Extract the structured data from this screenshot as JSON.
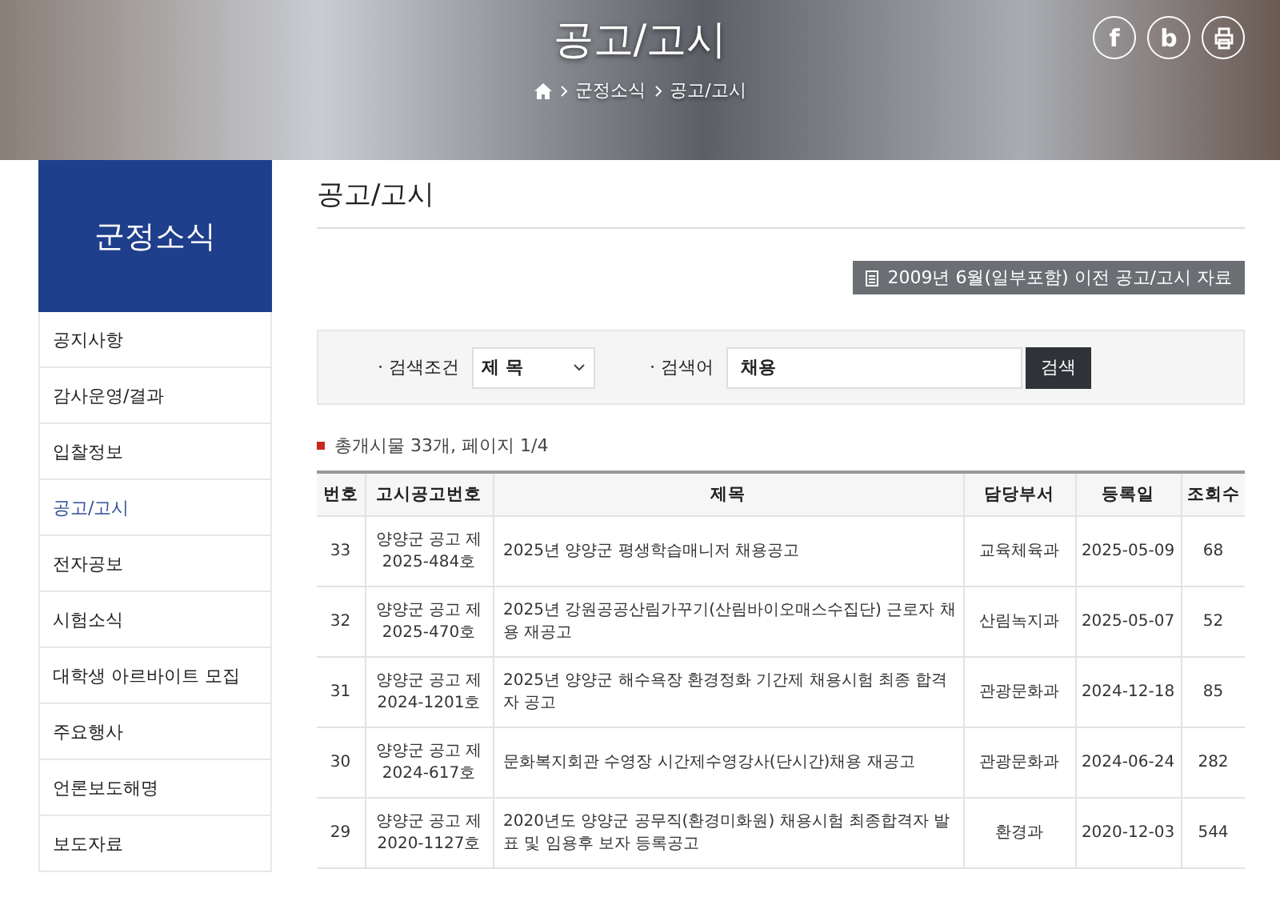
{
  "header": {
    "title": "공고/고시",
    "breadcrumb": [
      "군정소식",
      "공고/고시"
    ],
    "social_buttons": [
      {
        "kind": "letter",
        "glyph": "f"
      },
      {
        "kind": "letter",
        "glyph": "b"
      },
      {
        "kind": "print"
      }
    ]
  },
  "sidebar": {
    "title": "군정소식",
    "items": [
      {
        "label": "공지사항",
        "selected": false
      },
      {
        "label": "감사운영/결과",
        "selected": false
      },
      {
        "label": "입찰정보",
        "selected": false
      },
      {
        "label": "공고/고시",
        "selected": true
      },
      {
        "label": "전자공보",
        "selected": false
      },
      {
        "label": "시험소식",
        "selected": false
      },
      {
        "label": "대학생 아르바이트 모집",
        "selected": false
      },
      {
        "label": "주요행사",
        "selected": false
      },
      {
        "label": "언론보도해명",
        "selected": false
      },
      {
        "label": "보도자료",
        "selected": false
      }
    ]
  },
  "content": {
    "title": "공고/고시",
    "archive_button": "2009년 6월(일부포함) 이전 공고/고시 자료",
    "search": {
      "condition_label": "· 검색조건",
      "condition_value": "제 목",
      "keyword_label": "· 검색어",
      "keyword_value": "채용",
      "button": "검색"
    },
    "summary": "총개시물 33개, 페이지 1/4",
    "table": {
      "columns": [
        "번호",
        "고시공고번호",
        "제목",
        "담당부서",
        "등록일",
        "조회수"
      ],
      "rows": [
        [
          "33",
          "양양군 공고 제 2025-484호",
          "2025년 양양군 평생학습매니저 채용공고",
          "교육체육과",
          "2025-05-09",
          "68"
        ],
        [
          "32",
          "양양군 공고 제 2025-470호",
          "2025년 강원공공산림가꾸기(산림바이오매스수집단) 근로자 채용 재공고",
          "산림녹지과",
          "2025-05-07",
          "52"
        ],
        [
          "31",
          "양양군 공고 제 2024-1201호",
          "2025년 양양군 해수욕장 환경정화 기간제 채용시험 최종 합격자 공고",
          "관광문화과",
          "2024-12-18",
          "85"
        ],
        [
          "30",
          "양양군 공고 제 2024-617호",
          "문화복지회관 수영장 시간제수영강사(단시간)채용 재공고",
          "관광문화과",
          "2024-06-24",
          "282"
        ],
        [
          "29",
          "양양군 공고 제 2020-1127호",
          "2020년도 양양군 공무직(환경미화원) 채용시험 최종합격자 발표 및 임용후 보자 등록공고",
          "환경과",
          "2020-12-03",
          "544"
        ]
      ]
    }
  }
}
